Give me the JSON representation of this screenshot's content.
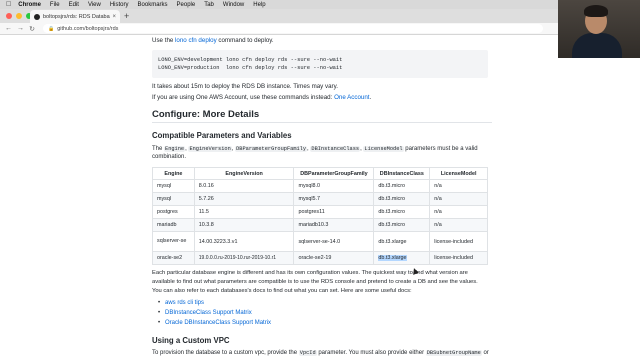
{
  "menubar": {
    "items": [
      "Chrome",
      "File",
      "Edit",
      "View",
      "History",
      "Bookmarks",
      "People",
      "Tab",
      "Window",
      "Help"
    ]
  },
  "browser": {
    "tab_title": "boltopsjrs/rds: RDS Database",
    "url": "github.com/boltopsjrs/rds",
    "traffic_colors": [
      "#ff5f57",
      "#febc2e",
      "#28c840"
    ]
  },
  "doc": {
    "deploy_intro_pre": "Use the ",
    "deploy_intro_link": "lono cfn deploy",
    "deploy_intro_post": " command to deploy.",
    "code_lines": [
      "LONO_ENV=development lono cfn deploy rds --sure --no-wait",
      "LONO_ENV=production  lono cfn deploy rds --sure --no-wait"
    ],
    "deploy_time_note": "It takes about 15m to deploy the RDS DB instance. Times may vary.",
    "one_account_pre": "If you are using One AWS Account, use these commands instead: ",
    "one_account_link": "One Account",
    "one_account_post": ".",
    "more_details_heading": "Configure: More Details",
    "compat_heading": "Compatible Parameters and Variables",
    "compat_text_1": "The",
    "compat_code": [
      "Engine",
      "EngineVersion",
      "DBParameterGroupFamily",
      "DBInstanceClass",
      "LicenseModel"
    ],
    "compat_text_2": "parameters must be a valid",
    "compat_text_3": "combination.",
    "table": {
      "headers": [
        "Engine",
        "EngineVersion",
        "DBParameterGroupFamily",
        "DBInstanceClass",
        "LicenseModel"
      ],
      "rows": [
        [
          "mysql",
          "8.0.16",
          "mysql8.0",
          "db.t3.micro",
          "n/a"
        ],
        [
          "mysql",
          "5.7.26",
          "mysql5.7",
          "db.t3.micro",
          "n/a"
        ],
        [
          "postgres",
          "11.5",
          "postgres11",
          "db.t3.micro",
          "n/a"
        ],
        [
          "mariadb",
          "10.3.8",
          "mariadb10.3",
          "db.t3.micro",
          "n/a"
        ],
        [
          "sqlserver-se",
          "14.00.3223.3.v1",
          "sqlserver-se-14.0",
          "db.t3.xlarge",
          "license-included"
        ],
        [
          "oracle-se2",
          "19.0.0.0.ru-2019-10.rur-2019-10.r1",
          "oracle-se2-19",
          "db.t3.xlarge",
          "license-included"
        ]
      ]
    },
    "para_1": "Each particular database engine is different and has its own configuration values. The quickest way to find what version are",
    "para_2": "available to find out what parameters are compatible is to use the RDS console and pretend to create a DB and see the values.",
    "para_3": "You can also refer to each databases's docs to find out what you can set. Here are some useful docs:",
    "doc_links": [
      "aws rds cli tips",
      "DBInstanceClass Support Matrix",
      "Oracle DBInstanceClass Support Matrix"
    ],
    "custom_vpc_heading": "Using a Custom VPC",
    "vpc_text_1": "To provision the database to a custom vpc, provide the",
    "vpc_code_1": "VpcId",
    "vpc_text_2": "parameter. You must also provide either",
    "vpc_code_2": "DBSubnetGroupName",
    "vpc_text_3": "or"
  }
}
